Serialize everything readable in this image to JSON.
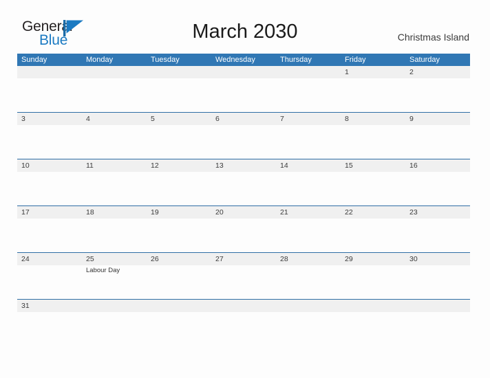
{
  "brand": {
    "name_part1": "General",
    "name_part2": "Blue",
    "flag_icon": "blue-triangle-flag-icon",
    "color_dark": "#231f20",
    "color_blue": "#1b7ac2"
  },
  "header": {
    "title": "March 2030",
    "location": "Christmas Island"
  },
  "theme": {
    "header_bar_color": "#3077b4",
    "row_divider_color": "#2e6da4",
    "date_band_color": "#f0f0f0",
    "page_background": "#fdfdfd",
    "text_color": "#3a3a3a"
  },
  "calendar": {
    "month": "March",
    "year": "2030",
    "weekdays": [
      "Sunday",
      "Monday",
      "Tuesday",
      "Wednesday",
      "Thursday",
      "Friday",
      "Saturday"
    ],
    "weeks": [
      {
        "days": [
          {
            "num": "",
            "events": []
          },
          {
            "num": "",
            "events": []
          },
          {
            "num": "",
            "events": []
          },
          {
            "num": "",
            "events": []
          },
          {
            "num": "",
            "events": []
          },
          {
            "num": "1",
            "events": []
          },
          {
            "num": "2",
            "events": []
          }
        ]
      },
      {
        "days": [
          {
            "num": "3",
            "events": []
          },
          {
            "num": "4",
            "events": []
          },
          {
            "num": "5",
            "events": []
          },
          {
            "num": "6",
            "events": []
          },
          {
            "num": "7",
            "events": []
          },
          {
            "num": "8",
            "events": []
          },
          {
            "num": "9",
            "events": []
          }
        ]
      },
      {
        "days": [
          {
            "num": "10",
            "events": []
          },
          {
            "num": "11",
            "events": []
          },
          {
            "num": "12",
            "events": []
          },
          {
            "num": "13",
            "events": []
          },
          {
            "num": "14",
            "events": []
          },
          {
            "num": "15",
            "events": []
          },
          {
            "num": "16",
            "events": []
          }
        ]
      },
      {
        "days": [
          {
            "num": "17",
            "events": []
          },
          {
            "num": "18",
            "events": []
          },
          {
            "num": "19",
            "events": []
          },
          {
            "num": "20",
            "events": []
          },
          {
            "num": "21",
            "events": []
          },
          {
            "num": "22",
            "events": []
          },
          {
            "num": "23",
            "events": []
          }
        ]
      },
      {
        "days": [
          {
            "num": "24",
            "events": []
          },
          {
            "num": "25",
            "events": [
              "Labour Day"
            ]
          },
          {
            "num": "26",
            "events": []
          },
          {
            "num": "27",
            "events": []
          },
          {
            "num": "28",
            "events": []
          },
          {
            "num": "29",
            "events": []
          },
          {
            "num": "30",
            "events": []
          }
        ]
      },
      {
        "short": true,
        "days": [
          {
            "num": "31",
            "events": []
          },
          {
            "num": "",
            "events": []
          },
          {
            "num": "",
            "events": []
          },
          {
            "num": "",
            "events": []
          },
          {
            "num": "",
            "events": []
          },
          {
            "num": "",
            "events": []
          },
          {
            "num": "",
            "events": []
          }
        ]
      }
    ]
  }
}
